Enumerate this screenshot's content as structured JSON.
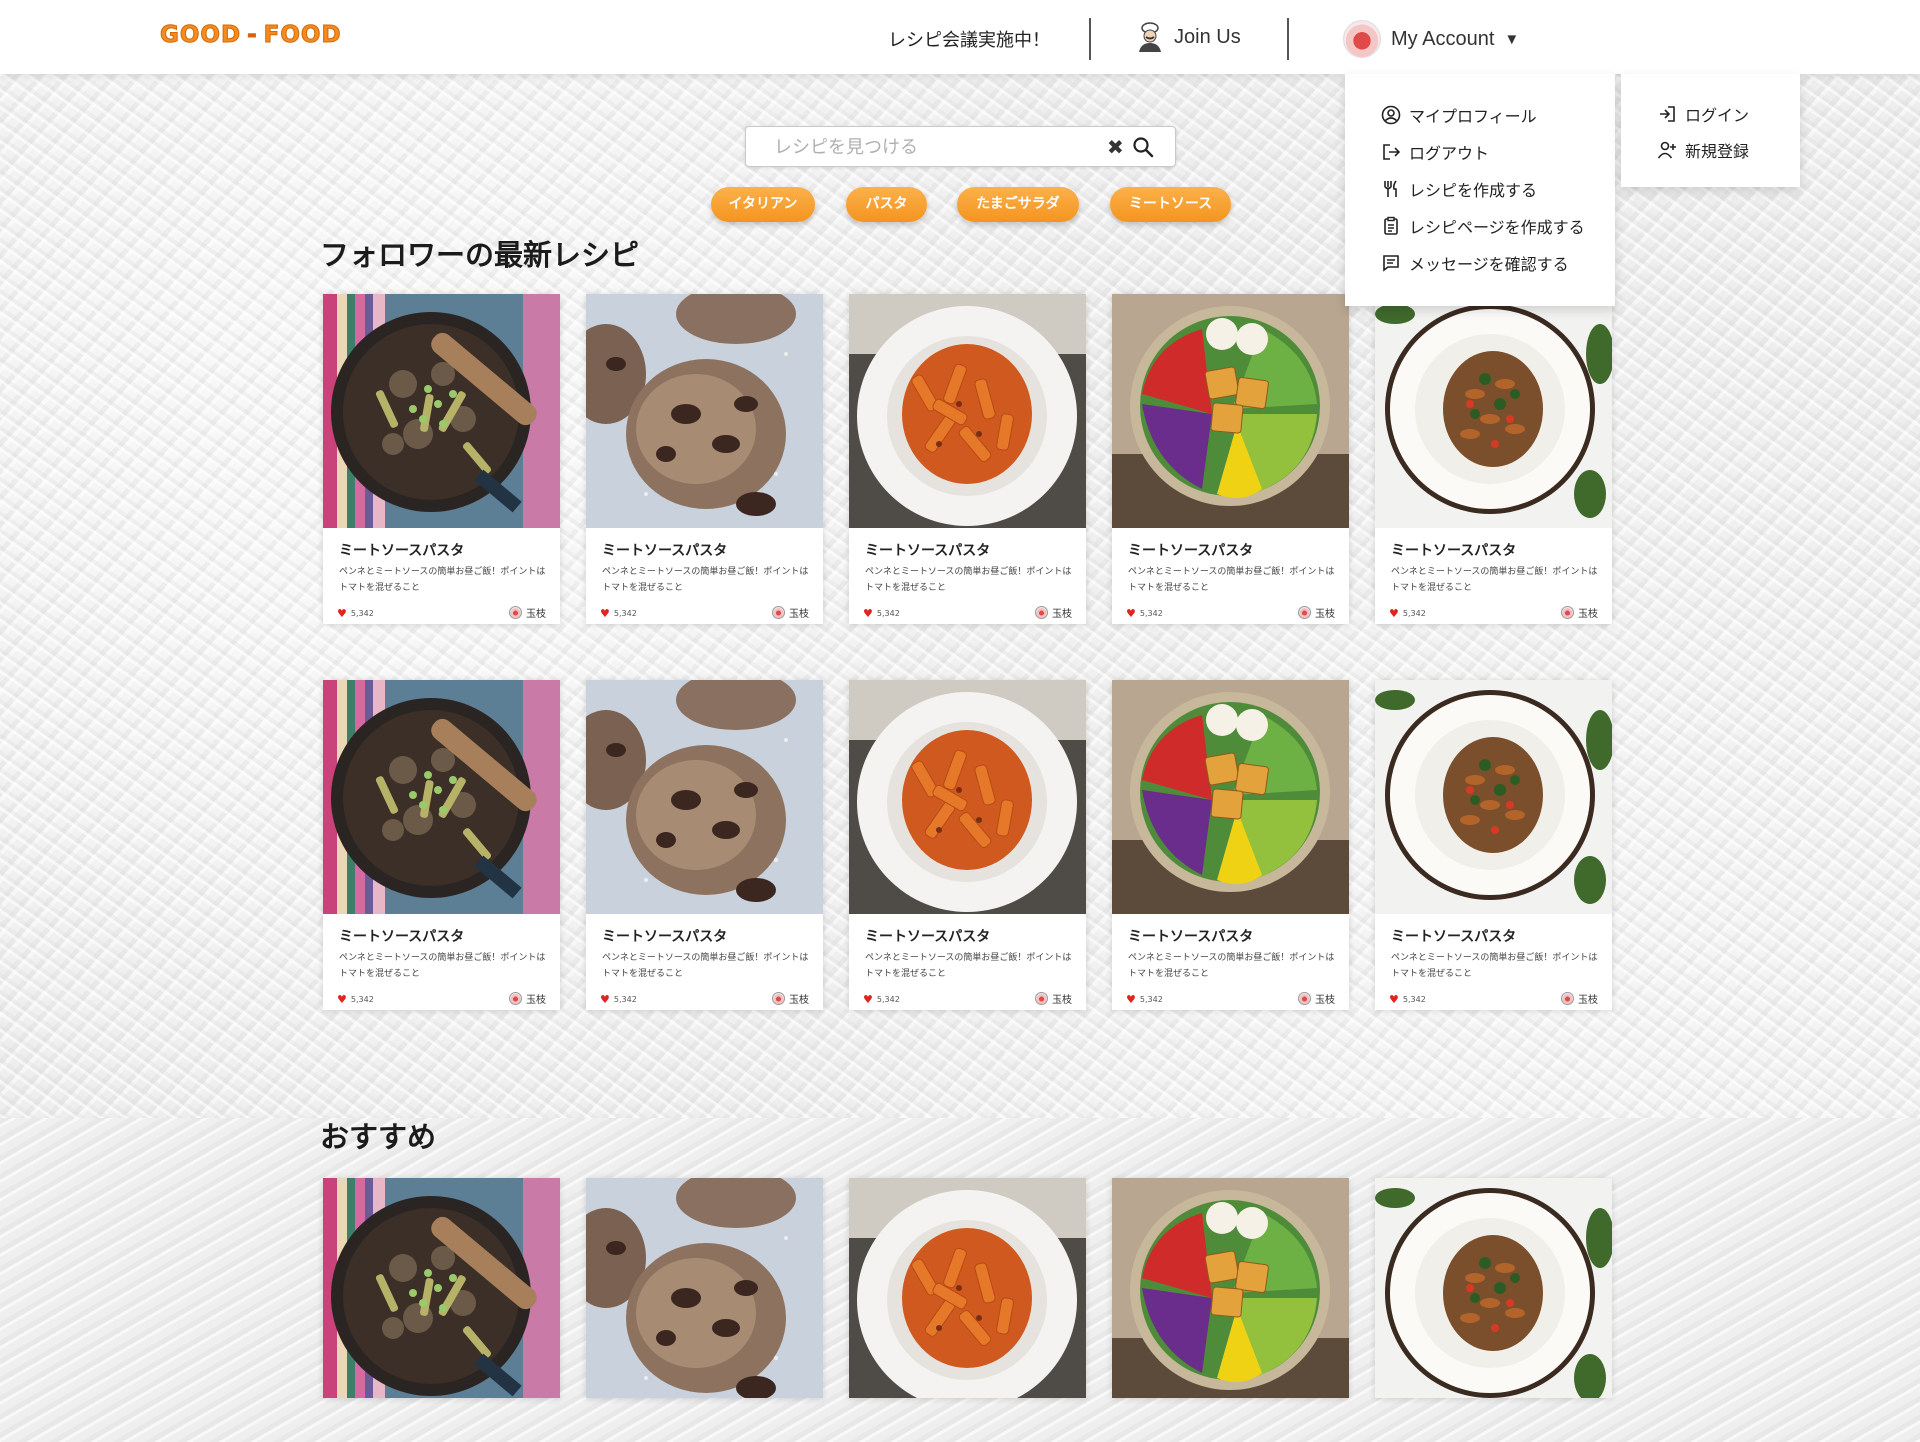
{
  "header": {
    "logo_left": "GOOD",
    "logo_sep": "-",
    "logo_right": "FOOD",
    "announcement": "レシピ会議実施中！",
    "join_label": "Join Us",
    "account_label": "My Account",
    "caret": "▼"
  },
  "account_menu": {
    "items": [
      {
        "label": "マイプロフィール",
        "icon": "user-circle-icon"
      },
      {
        "label": "ログアウト",
        "icon": "logout-icon"
      },
      {
        "label": "レシピを作成する",
        "icon": "utensils-icon"
      },
      {
        "label": "レシピページを作成する",
        "icon": "clipboard-icon"
      },
      {
        "label": "メッセージを確認する",
        "icon": "message-icon"
      }
    ]
  },
  "auth_menu": {
    "items": [
      {
        "label": "ログイン",
        "icon": "login-icon"
      },
      {
        "label": "新規登録",
        "icon": "user-plus-icon"
      }
    ]
  },
  "search": {
    "placeholder": "レシピを見つける",
    "clear_glyph": "✖"
  },
  "tags": [
    "イタリアン",
    "パスタ",
    "たまごサラダ",
    "ミートソース"
  ],
  "sections": {
    "followers_title": "フォロワーの最新レシピ",
    "recommended_title": "おすすめ"
  },
  "card": {
    "title": "ミートソースパスタ",
    "description": "ペンネとミートソースの簡単お昼ご飯！ポイントはトマトを混ぜること",
    "likes": "5,342",
    "author": "玉枝"
  },
  "card_images": [
    "stir-fry-pan",
    "chocolate-cookie",
    "penne-bolognese",
    "salad-bowl",
    "fusilli-plate"
  ],
  "colors": {
    "brand_orange": "#f58a1f",
    "tag_orange": "#f49420",
    "heart_red": "#e2241f"
  }
}
